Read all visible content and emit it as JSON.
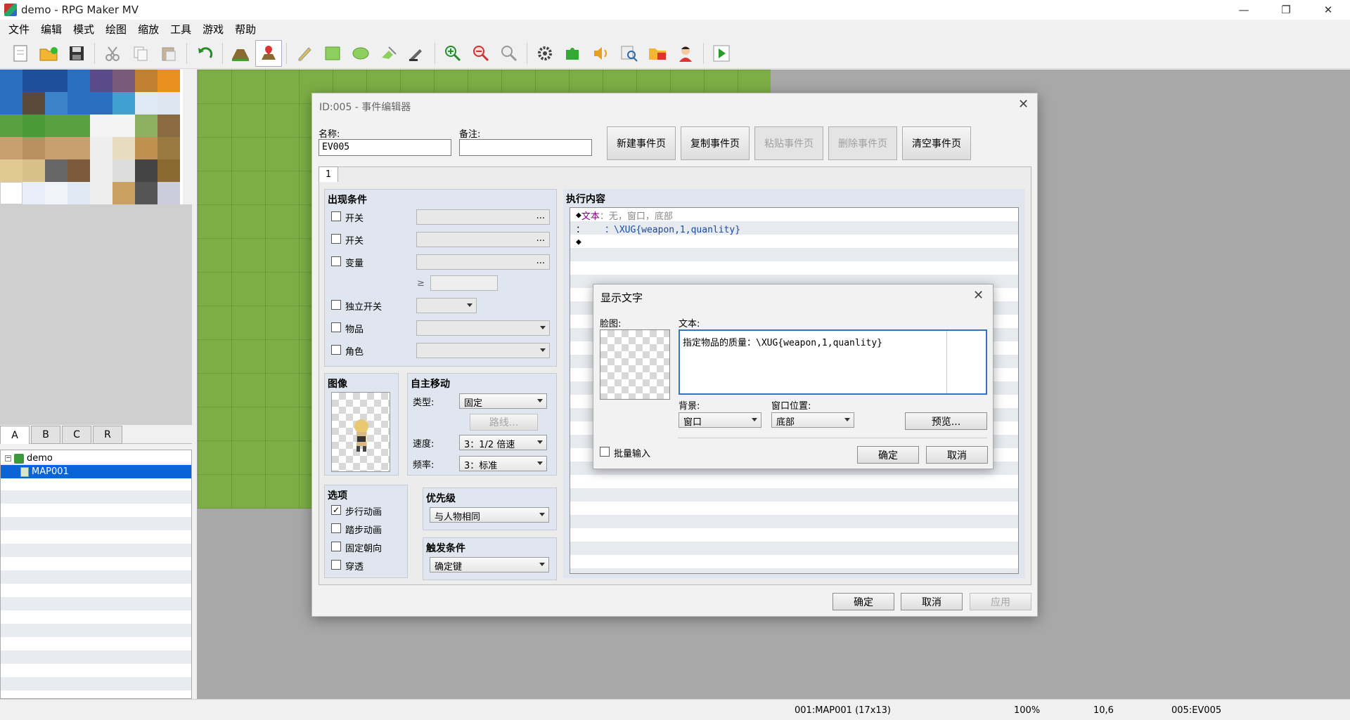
{
  "window": {
    "title": "demo - RPG Maker MV"
  },
  "menu": [
    "文件",
    "编辑",
    "模式",
    "绘图",
    "缩放",
    "工具",
    "游戏",
    "帮助"
  ],
  "toolbar_icons": [
    "new-project-icon",
    "open-project-icon",
    "save-project-icon",
    "cut-icon",
    "copy-icon",
    "paste-icon",
    "undo-icon",
    "map-mode-icon",
    "event-mode-icon",
    "pencil-icon",
    "rectangle-icon",
    "ellipse-icon",
    "fill-icon",
    "shadow-pen-icon",
    "zoom-in-icon",
    "zoom-out-icon",
    "actual-size-icon",
    "database-icon",
    "plugin-manager-icon",
    "sound-test-icon",
    "event-searcher-icon",
    "resource-manager-icon",
    "character-generator-icon",
    "playtest-icon"
  ],
  "tile_tabs": [
    "A",
    "B",
    "C",
    "R"
  ],
  "map_tree": {
    "project": "demo",
    "map": "MAP001"
  },
  "status": {
    "map": "001:MAP001 (17x13)",
    "zoom": "100%",
    "coord": "10,6",
    "event": "005:EV005"
  },
  "event_editor": {
    "title": "ID:005 - 事件编辑器",
    "name_label": "名称:",
    "name_value": "EV005",
    "note_label": "备注:",
    "note_value": "",
    "buttons": {
      "new_page": "新建事件页",
      "copy_page": "复制事件页",
      "paste_page": "粘贴事件页",
      "delete_page": "删除事件页",
      "clear_page": "清空事件页"
    },
    "page_tab": "1",
    "conditions": {
      "title": "出现条件",
      "switch1": "开关",
      "switch2": "开关",
      "variable": "变量",
      "gte": "≥",
      "self_switch": "独立开关",
      "item": "物品",
      "actor": "角色",
      "dots": "..."
    },
    "image": {
      "title": "图像"
    },
    "autonomous": {
      "title": "自主移动",
      "type_label": "类型:",
      "type_value": "固定",
      "route_btn": "路线...",
      "speed_label": "速度:",
      "speed_value": "3：1/2 倍速",
      "freq_label": "频率:",
      "freq_value": "3：标准"
    },
    "options": {
      "title": "选项",
      "walking": "步行动画",
      "stepping": "踏步动画",
      "direction_fix": "固定朝向",
      "through": "穿透",
      "walking_checked": "✓"
    },
    "priority": {
      "title": "优先级",
      "value": "与人物相同"
    },
    "trigger": {
      "title": "触发条件",
      "value": "确定键"
    },
    "contents": {
      "title": "执行内容",
      "row1_bullet": "◆",
      "row1_cmd": "文本",
      "row1_params": "：无，窗口，底部",
      "row2_prefix": "：",
      "row2_text": "：\\XUG{weapon,1,quanlity}",
      "row3_bullet": "◆"
    },
    "footer": {
      "ok": "确定",
      "cancel": "取消",
      "apply": "应用"
    }
  },
  "show_text": {
    "title": "显示文字",
    "face_label": "脸图:",
    "text_label": "文本:",
    "text_value": "指定物品的质量：\\XUG{weapon,1,quanlity}",
    "bg_label": "背景:",
    "bg_value": "窗口",
    "pos_label": "窗口位置:",
    "pos_value": "底部",
    "preview_btn": "预览...",
    "batch_label": "批量输入",
    "ok": "确定",
    "cancel": "取消"
  }
}
